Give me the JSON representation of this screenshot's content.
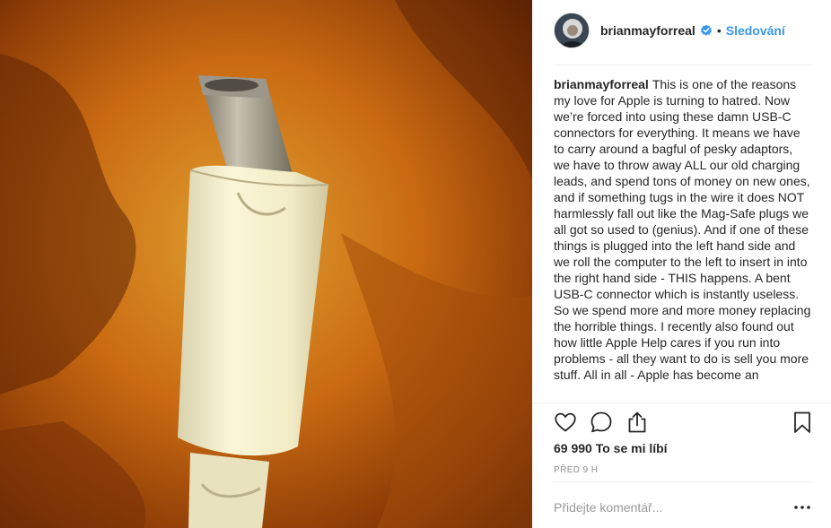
{
  "post": {
    "username": "brianmayforreal",
    "follow_label": "Sledování",
    "separator": "•",
    "caption_text": "This is one of the reasons my love for Apple is turning to hatred. Now we’re forced into using these damn USB-C connectors for everything. It means we have to carry around a bagful of pesky adaptors, we have to throw away ALL our old charging leads, and spend tons of money on new ones, and if something tugs in the wire it does NOT harmlessly fall out like the Mag-Safe plugs we all got so used to (genius). And if one of these things is plugged into the left hand side and we roll the computer to the left to insert in into the right hand side - THIS happens. A bent USB-C connector which is instantly useless. So we spend more and more money replacing the horrible things. I recently also found out how little Apple Help cares if you run into problems - all they want to do is sell you more stuff. All in all - Apple has become an",
    "likes": "69 990 To se mi líbí",
    "timestamp": "PŘED 9 H",
    "comment_placeholder": "Přidejte komentář...",
    "more_label": "..."
  },
  "colors": {
    "accent": "#3897f0",
    "text": "#262626",
    "muted": "#8e8e8e",
    "divider": "#efefef"
  },
  "icons": [
    "verified-badge-icon",
    "heart-icon",
    "comment-icon",
    "share-icon",
    "bookmark-icon",
    "more-options-icon"
  ]
}
